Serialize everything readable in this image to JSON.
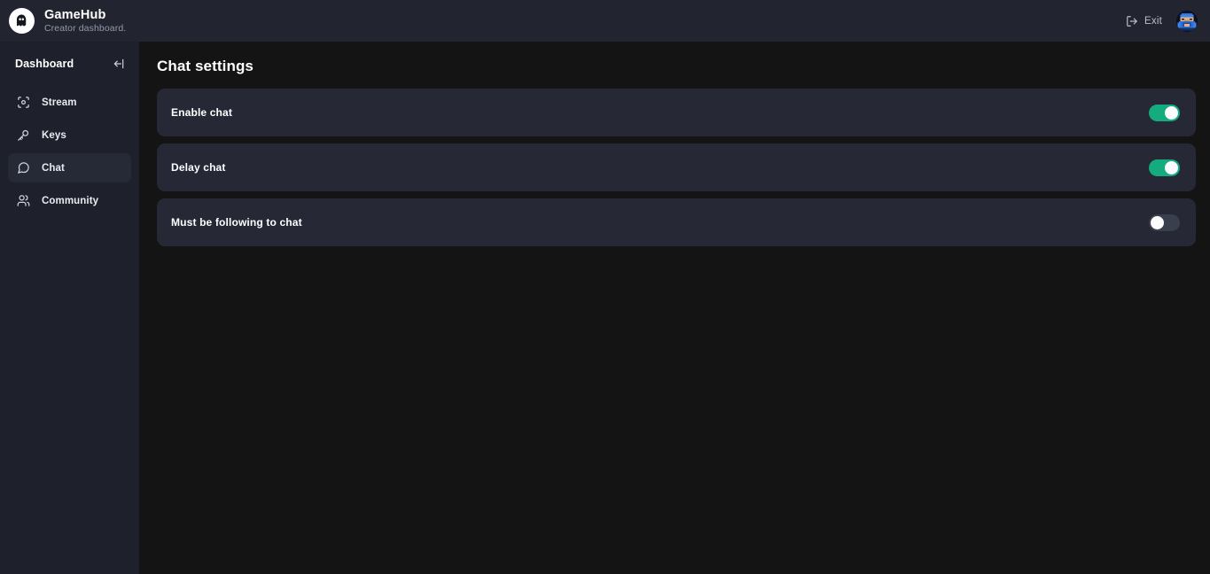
{
  "topbar": {
    "brand_title": "GameHub",
    "brand_subtitle": "Creator dashboard.",
    "logo_icon": "ghost-logo-icon",
    "exit_label": "Exit",
    "exit_icon": "logout-icon",
    "avatar_icon": "user-avatar-pixelart"
  },
  "sidebar": {
    "title": "Dashboard",
    "collapse_icon": "collapse-sidebar-icon",
    "items": [
      {
        "label": "Stream",
        "icon": "focus-scan-icon",
        "active": false
      },
      {
        "label": "Keys",
        "icon": "key-icon",
        "active": false
      },
      {
        "label": "Chat",
        "icon": "message-bubble-icon",
        "active": true
      },
      {
        "label": "Community",
        "icon": "users-icon",
        "active": false
      }
    ]
  },
  "main": {
    "page_title": "Chat settings",
    "settings": [
      {
        "label": "Enable chat",
        "enabled": true
      },
      {
        "label": "Delay chat",
        "enabled": true
      },
      {
        "label": "Must be following to chat",
        "enabled": false
      }
    ]
  },
  "colors": {
    "app_background": "#141414",
    "sidebar_background": "#1e212b",
    "topbar_background": "#22252f",
    "card_background": "#262935",
    "toggle_on": "#14ab7f",
    "toggle_off": "#3a3f4d",
    "accent_text": "#ffffff",
    "muted_text": "#9099ab"
  }
}
